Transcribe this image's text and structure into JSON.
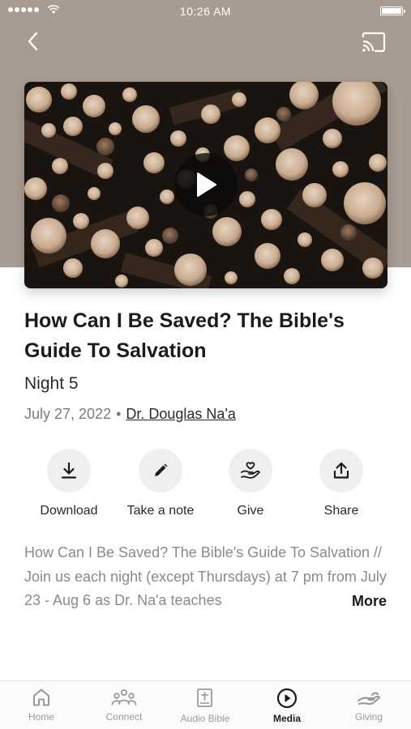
{
  "status_bar": {
    "time": "10:26 AM"
  },
  "video": {
    "play_icon": "play-icon"
  },
  "sermon": {
    "title": "How Can I Be Saved? The Bible's Guide To Salvation",
    "subtitle": "Night 5",
    "date": "July 27, 2022",
    "separator": "•",
    "speaker": "Dr. Douglas Na'a"
  },
  "actions": [
    {
      "label": "Download",
      "icon": "download-icon"
    },
    {
      "label": "Take a note",
      "icon": "pencil-icon"
    },
    {
      "label": "Give",
      "icon": "give-icon"
    },
    {
      "label": "Share",
      "icon": "share-icon"
    }
  ],
  "description": {
    "text": "How Can I Be Saved? The Bible's Guide To Salvation // Join us each night (except Thursdays) at 7 pm from July 23 - Aug 6 as Dr. Na'a teaches",
    "more_label": "More"
  },
  "tabbar": {
    "items": [
      {
        "label": "Home",
        "icon": "home-icon",
        "active": false
      },
      {
        "label": "Connect",
        "icon": "people-icon",
        "active": false
      },
      {
        "label": "Audio Bible",
        "icon": "bible-icon",
        "active": false
      },
      {
        "label": "Media",
        "icon": "play-circle-icon",
        "active": true
      },
      {
        "label": "Giving",
        "icon": "giving-hand-icon",
        "active": false
      }
    ]
  },
  "colors": {
    "hero_background": "#a89b91",
    "accent": "#1b1b1b",
    "muted_text": "#8a8a8a"
  }
}
